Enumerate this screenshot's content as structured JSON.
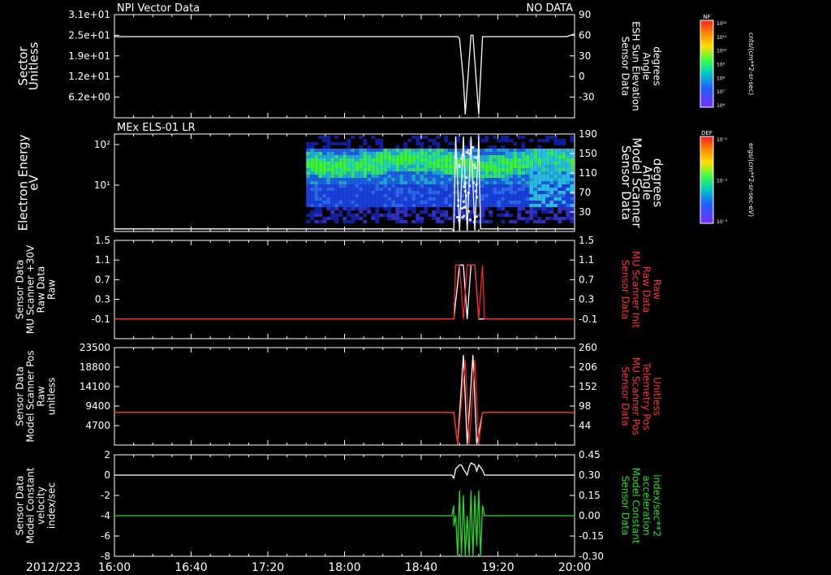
{
  "date_label": "2012/223",
  "x_ticks": [
    "16:00",
    "16:40",
    "17:20",
    "18:00",
    "18:40",
    "19:20",
    "20:00"
  ],
  "chart_data": [
    {
      "type": "line",
      "title": "NPI Vector Data",
      "title_right": "NO DATA",
      "ylabel_left": [
        "Sector",
        "Unitless"
      ],
      "yticks_left": [
        "3.1e+01",
        "2.5e+01",
        "1.9e+01",
        "1.2e+01",
        "6.2e+00"
      ],
      "ylabel_right": [
        "Sensor Data",
        "ESH Sun Elevation",
        "Angle",
        "degrees"
      ],
      "ylabel_right_color": "#ffffff",
      "yticks_right": [
        "90",
        "60",
        "30",
        "0",
        "-30"
      ],
      "ylim_right": [
        -60,
        90
      ],
      "series": [
        {
          "color": "#ffffff",
          "x": [
            "16:00",
            "18:59",
            "19:00",
            "19:02",
            "19:03",
            "19:06",
            "19:07",
            "19:10",
            "19:12",
            "19:56",
            "20:00"
          ],
          "y": [
            58,
            58,
            55,
            -5,
            -55,
            60,
            60,
            -55,
            58,
            58,
            62
          ]
        }
      ]
    },
    {
      "type": "heatmap",
      "title": "MEx ELS-01 LR",
      "ylabel_left": [
        "Electron Energy",
        "eV"
      ],
      "yticks_left": [
        "10²",
        "10¹"
      ],
      "ylabel_right": [
        "Sensor Data",
        "Model Scanner",
        "Angle",
        "degrees"
      ],
      "ylabel_right_color": "#ffffff",
      "yticks_right": [
        "190",
        "150",
        "110",
        "70",
        "30"
      ],
      "ylim_right": [
        0,
        190
      ],
      "heatmap_range": [
        "17:40",
        "20:00"
      ],
      "series": [
        {
          "color": "#ffffff",
          "x": [
            "16:00",
            "18:56",
            "18:57",
            "18:58",
            "19:00",
            "19:02",
            "19:04",
            "19:06",
            "19:08",
            "19:10",
            "19:11",
            "20:00"
          ],
          "y": [
            5,
            5,
            -5,
            185,
            -5,
            185,
            -5,
            185,
            -5,
            185,
            5,
            5
          ]
        }
      ]
    },
    {
      "type": "line",
      "ylabel_left": [
        "Sensor Data",
        "MU Scanner +30V",
        "Raw Data",
        "Raw"
      ],
      "yticks_left": [
        "1.5",
        "1.1",
        "0.7",
        "0.3",
        "-0.1"
      ],
      "ylim_left": [
        -0.5,
        1.5
      ],
      "ylabel_right": [
        "Sensor Data",
        "MU Scanner Init",
        "Raw Data",
        "Raw"
      ],
      "ylabel_right_color": "#ff3030",
      "yticks_right": [
        "1.5",
        "1.1",
        "0.7",
        "0.3",
        "-0.1"
      ],
      "series": [
        {
          "color": "#ffffff",
          "x": [
            "16:00",
            "18:57",
            "19:00",
            "19:02",
            "19:04",
            "19:06",
            "19:08",
            "19:10",
            "19:12",
            "20:00"
          ],
          "y": [
            -0.1,
            -0.1,
            1.0,
            1.0,
            -0.1,
            1.0,
            1.0,
            -0.1,
            -0.1,
            -0.1
          ]
        },
        {
          "color": "#ff2020",
          "x": [
            "16:00",
            "18:57",
            "18:58",
            "19:00",
            "19:02",
            "19:04",
            "19:06",
            "19:08",
            "19:10",
            "19:12",
            "19:13",
            "20:00"
          ],
          "y": [
            -0.1,
            -0.1,
            1.0,
            1.0,
            -0.1,
            1.0,
            1.0,
            1.0,
            -0.1,
            1.0,
            -0.1,
            -0.1
          ]
        }
      ]
    },
    {
      "type": "line",
      "ylabel_left": [
        "Sensor Data",
        "Model Scanner Pos",
        "Raw",
        "unitless"
      ],
      "yticks_left": [
        "23500",
        "18800",
        "14100",
        "9400",
        "4700"
      ],
      "ylim_left": [
        0,
        23500
      ],
      "ylabel_right": [
        "Sensor Data",
        "MU Scanner Pos",
        "Telemetry Pos",
        "Unitless"
      ],
      "ylabel_right_color": "#ff3030",
      "yticks_right": [
        "260",
        "206",
        "152",
        "98",
        "44"
      ],
      "series": [
        {
          "color": "#ffffff",
          "x": [
            "16:00",
            "18:57",
            "18:59",
            "19:02",
            "19:04",
            "19:07",
            "19:09",
            "19:12",
            "20:00"
          ],
          "y": [
            7900,
            7900,
            0,
            21700,
            0,
            21700,
            0,
            7900,
            7900
          ]
        },
        {
          "color": "#ff2020",
          "x": [
            "16:00",
            "18:57",
            "18:59",
            "19:03",
            "19:05",
            "19:08",
            "19:10",
            "19:12",
            "20:00"
          ],
          "y": [
            7900,
            7900,
            0,
            20500,
            0,
            20500,
            0,
            7900,
            7900
          ]
        }
      ]
    },
    {
      "type": "line",
      "ylabel_left": [
        "Sensor Data",
        "Model Constant",
        "velocity",
        "index/sec"
      ],
      "yticks_left": [
        "2",
        "0",
        "-2",
        "-4",
        "-6",
        "-8"
      ],
      "ylim_left": [
        -8,
        2
      ],
      "ylabel_right": [
        "Sensor Data",
        "Model Constant",
        "acceleration",
        "index/sec**2"
      ],
      "ylabel_right_color": "#20e020",
      "yticks_right": [
        "0.45",
        "0.30",
        "0.15",
        "0.00",
        "-0.15",
        "-0.30"
      ],
      "series": [
        {
          "color": "#ffffff",
          "x": [
            "16:00",
            "18:56",
            "18:57",
            "18:58",
            "19:00",
            "19:01",
            "19:02",
            "19:04",
            "19:05",
            "19:06",
            "19:08",
            "19:09",
            "19:10",
            "19:12",
            "19:13",
            "20:00"
          ],
          "y": [
            0,
            0,
            -0.3,
            0.6,
            1.0,
            1.0,
            0.6,
            0.0,
            0.8,
            1.2,
            1.0,
            0.4,
            1.0,
            0.5,
            0,
            0
          ]
        },
        {
          "color": "#20e020",
          "x": [
            "16:00",
            "18:56",
            "18:57",
            "18:57",
            "18:58",
            "18:59",
            "19:00",
            "19:01",
            "19:02",
            "19:03",
            "19:04",
            "19:05",
            "19:06",
            "19:07",
            "19:08",
            "19:09",
            "19:10",
            "19:11",
            "19:12",
            "19:13",
            "20:00"
          ],
          "y": [
            -4,
            -4,
            -3,
            -5,
            -4,
            -8,
            -1.5,
            -8,
            -2,
            -8,
            -4,
            -8,
            -1.5,
            -8,
            -2,
            -7,
            -1.5,
            -8,
            -3,
            -4,
            -4
          ]
        }
      ]
    }
  ],
  "colorbars": [
    {
      "label": "NF",
      "unit": "cnts/(cm**2-sr-sec)",
      "ticks": [
        "10¹²",
        "10¹¹",
        "10¹⁰",
        "10⁹",
        "10⁸",
        "10⁷",
        "10⁶"
      ]
    },
    {
      "label": "DEF",
      "unit": "ergs/(cm**2-sr-sec-eV)",
      "ticks": [
        "10⁻¹",
        "10⁻²",
        "10⁻³"
      ]
    }
  ],
  "colors": {
    "background": "#000000",
    "axes": "#ffffff",
    "red_trace": "#ff2020",
    "green_trace": "#20e020"
  }
}
